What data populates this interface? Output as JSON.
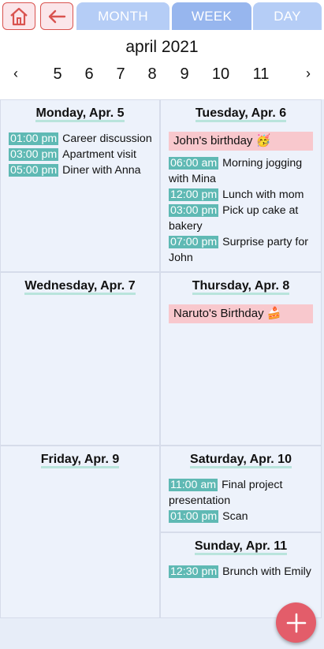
{
  "tabs": {
    "month": "MONTH",
    "week": "WEEK",
    "day": "DAY",
    "active": "week"
  },
  "header": {
    "month_title": "april 2021",
    "prev": "‹",
    "next": "›",
    "days": [
      "5",
      "6",
      "7",
      "8",
      "9",
      "10",
      "11"
    ]
  },
  "days": {
    "mon": {
      "title": "Monday, Apr. 5",
      "events": [
        {
          "time": "01:00 pm",
          "text": "Career discussion"
        },
        {
          "time": "03:00 pm",
          "text": "Apartment visit"
        },
        {
          "time": "05:00 pm",
          "text": "Diner with Anna"
        }
      ]
    },
    "tue": {
      "title": "Tuesday, Apr. 6",
      "allday": "John's birthday 🥳",
      "events": [
        {
          "time": "06:00 am",
          "text": "Morning jogging with Mina"
        },
        {
          "time": "12:00 pm",
          "text": "Lunch with mom"
        },
        {
          "time": "03:00 pm",
          "text": "Pick up cake at bakery"
        },
        {
          "time": "07:00 pm",
          "text": "Surprise party for John"
        }
      ]
    },
    "wed": {
      "title": "Wednesday, Apr. 7"
    },
    "thu": {
      "title": "Thursday, Apr. 8",
      "allday": "Naruto's Birthday 🍰"
    },
    "fri": {
      "title": "Friday, Apr. 9"
    },
    "sat": {
      "title": "Saturday, Apr. 10",
      "events": [
        {
          "time": "11:00 am",
          "text": "Final project presentation"
        },
        {
          "time": "01:00 pm",
          "text": "Scan"
        }
      ]
    },
    "sun": {
      "title": "Sunday, Apr. 11",
      "events": [
        {
          "time": "12:30 pm",
          "text": "Brunch with Emily"
        }
      ]
    }
  },
  "colors": {
    "accent_red": "#e35d6a",
    "tab": "#b5cdf6",
    "tab_active": "#97b6ee",
    "time_badge": "#5fb9b4",
    "allday": "#f8c8cd"
  },
  "icons": {
    "home": "home-icon",
    "back": "arrow-left-icon",
    "add": "plus-icon"
  }
}
